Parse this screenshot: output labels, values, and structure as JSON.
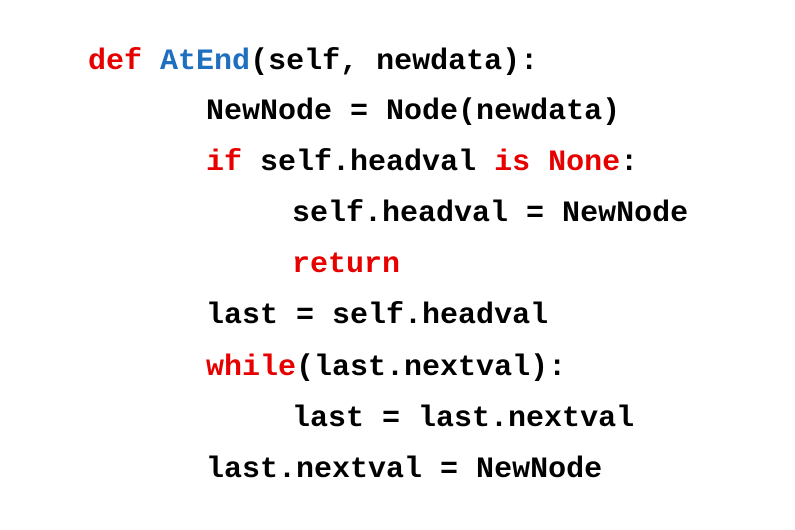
{
  "code": {
    "lines": [
      {
        "indent": 0,
        "tokens": [
          {
            "text": "def",
            "kind": "keyword"
          },
          {
            "text": " ",
            "kind": "plain"
          },
          {
            "text": "AtEnd",
            "kind": "function"
          },
          {
            "text": "(self, newdata):",
            "kind": "plain"
          }
        ]
      },
      {
        "indent": 1,
        "tokens": [
          {
            "text": "NewNode = Node(newdata)",
            "kind": "plain"
          }
        ]
      },
      {
        "indent": 1,
        "tokens": [
          {
            "text": "if",
            "kind": "keyword"
          },
          {
            "text": " self.headval ",
            "kind": "plain"
          },
          {
            "text": "is",
            "kind": "keyword"
          },
          {
            "text": " ",
            "kind": "plain"
          },
          {
            "text": "None",
            "kind": "keyword"
          },
          {
            "text": ":",
            "kind": "plain"
          }
        ]
      },
      {
        "indent": 2,
        "tokens": [
          {
            "text": "self.headval = NewNode",
            "kind": "plain"
          }
        ]
      },
      {
        "indent": 2,
        "tokens": [
          {
            "text": "return",
            "kind": "keyword"
          }
        ]
      },
      {
        "indent": 1,
        "tokens": [
          {
            "text": "last = self.headval",
            "kind": "plain"
          }
        ]
      },
      {
        "indent": 1,
        "tokens": [
          {
            "text": "while",
            "kind": "keyword"
          },
          {
            "text": "(last.nextval):",
            "kind": "plain"
          }
        ]
      },
      {
        "indent": 2,
        "tokens": [
          {
            "text": "last = last.nextval",
            "kind": "plain"
          }
        ]
      },
      {
        "indent": 1,
        "tokens": [
          {
            "text": "last.nextval = NewNode",
            "kind": "plain"
          }
        ]
      }
    ]
  },
  "colors": {
    "keyword": "#e60000",
    "function": "#1f6fbf",
    "plain": "#000000",
    "background": "#ffffff"
  }
}
